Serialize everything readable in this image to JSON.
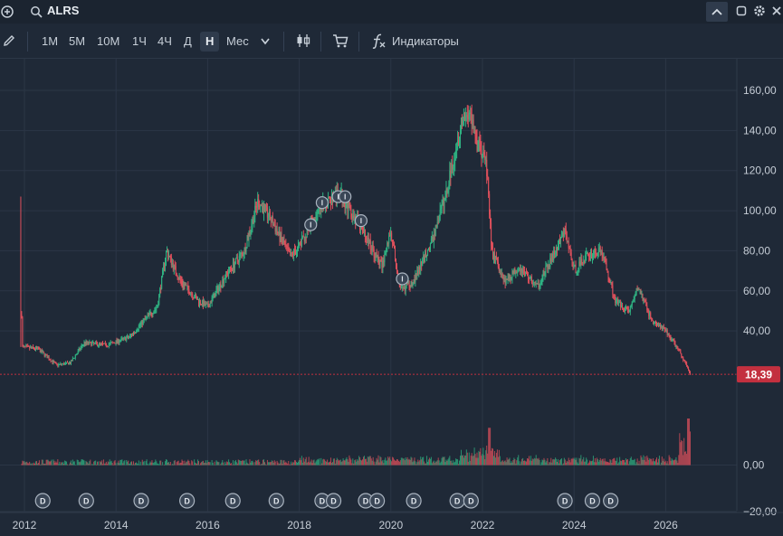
{
  "header": {
    "symbol": "ALRS"
  },
  "toolbar": {
    "intervals": [
      "1M",
      "5M",
      "10M",
      "1Ч",
      "4Ч",
      "Д",
      "Н",
      "Мес"
    ],
    "active_interval": "Н",
    "indicators_label": "Индикаторы"
  },
  "colors": {
    "up": "#2fb383",
    "down": "#e0505c",
    "price_tag": "#c3303f",
    "background": "#1f2937",
    "grid": "#2b3646"
  },
  "price_tag": "18,39",
  "chart_data": {
    "type": "candlestick",
    "x_ticks": [
      "2012",
      "2014",
      "2016",
      "2018",
      "2020",
      "2022",
      "2024",
      "2026"
    ],
    "y_ticks": [
      "160,00",
      "140,00",
      "120,00",
      "100,00",
      "80,00",
      "60,00",
      "40,00",
      "0,00",
      "−20,00"
    ],
    "price_ylim": [
      18,
      160
    ],
    "last_price": 18.39,
    "trend": [
      [
        2011.9,
        107
      ],
      [
        2011.95,
        32
      ],
      [
        2012.3,
        31
      ],
      [
        2012.7,
        23
      ],
      [
        2013.0,
        24
      ],
      [
        2013.3,
        34
      ],
      [
        2013.8,
        33
      ],
      [
        2014.3,
        37
      ],
      [
        2014.6,
        45
      ],
      [
        2014.9,
        52
      ],
      [
        2015.1,
        80
      ],
      [
        2015.4,
        65
      ],
      [
        2015.8,
        55
      ],
      [
        2016.0,
        52
      ],
      [
        2016.4,
        68
      ],
      [
        2016.8,
        80
      ],
      [
        2017.1,
        105
      ],
      [
        2017.4,
        95
      ],
      [
        2017.8,
        77
      ],
      [
        2018.0,
        82
      ],
      [
        2018.3,
        95
      ],
      [
        2018.6,
        105
      ],
      [
        2018.9,
        108
      ],
      [
        2019.2,
        97
      ],
      [
        2019.5,
        85
      ],
      [
        2019.8,
        72
      ],
      [
        2020.0,
        90
      ],
      [
        2020.2,
        60
      ],
      [
        2020.5,
        65
      ],
      [
        2020.9,
        85
      ],
      [
        2021.2,
        108
      ],
      [
        2021.5,
        140
      ],
      [
        2021.7,
        150
      ],
      [
        2021.9,
        135
      ],
      [
        2022.1,
        120
      ],
      [
        2022.2,
        80
      ],
      [
        2022.5,
        65
      ],
      [
        2022.8,
        72
      ],
      [
        2023.2,
        62
      ],
      [
        2023.6,
        80
      ],
      [
        2023.8,
        90
      ],
      [
        2024.0,
        70
      ],
      [
        2024.3,
        78
      ],
      [
        2024.6,
        80
      ],
      [
        2024.9,
        55
      ],
      [
        2025.2,
        50
      ],
      [
        2025.4,
        62
      ],
      [
        2025.7,
        45
      ],
      [
        2026.0,
        40
      ],
      [
        2026.3,
        30
      ],
      [
        2026.55,
        18.4
      ]
    ],
    "event_markers_top": [
      {
        "x": 2018.25,
        "y": 93
      },
      {
        "x": 2018.5,
        "y": 104
      },
      {
        "x": 2018.85,
        "y": 107
      },
      {
        "x": 2019.0,
        "y": 107
      },
      {
        "x": 2019.35,
        "y": 95
      },
      {
        "x": 2020.25,
        "y": 66
      }
    ],
    "dividend_markers": [
      2012.4,
      2013.35,
      2014.55,
      2015.55,
      2016.55,
      2017.5,
      2018.5,
      2018.75,
      2019.45,
      2019.7,
      2020.5,
      2021.45,
      2021.75,
      2023.8,
      2024.4,
      2024.8
    ]
  }
}
